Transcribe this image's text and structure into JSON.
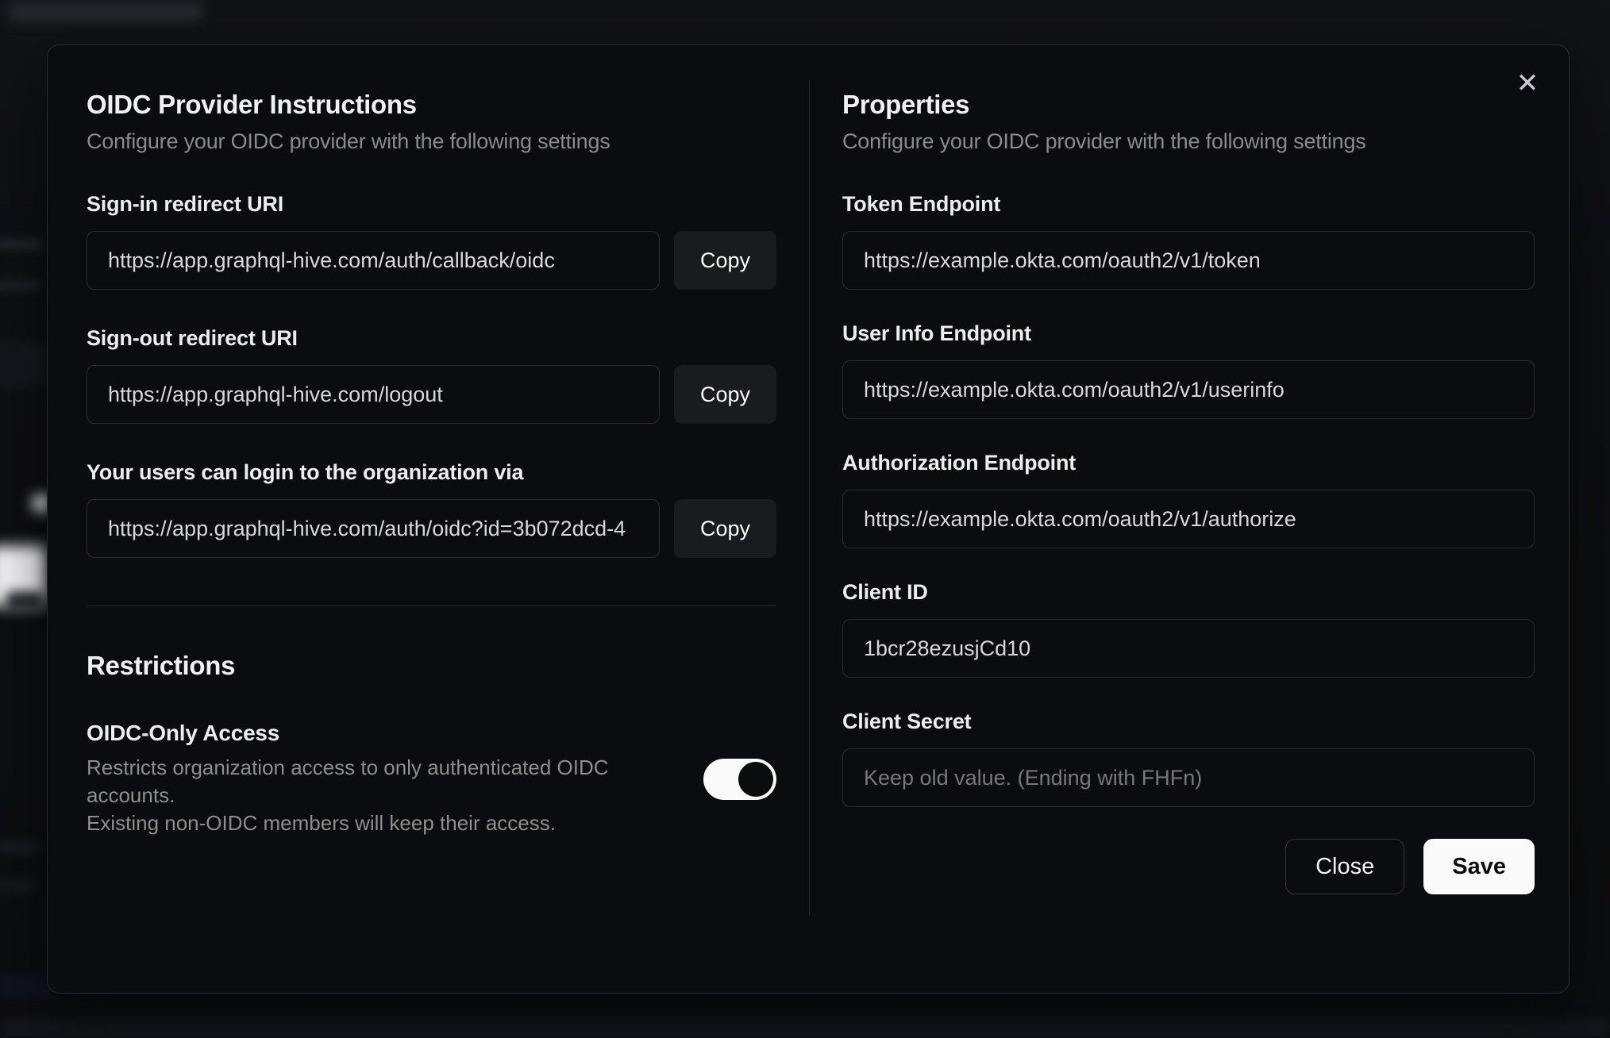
{
  "modal": {
    "close_icon": "✕",
    "left": {
      "title": "OIDC Provider Instructions",
      "subtitle": "Configure your OIDC provider with the following settings",
      "copy_label": "Copy",
      "fields": [
        {
          "label": "Sign-in redirect URI",
          "value": "https://app.graphql-hive.com/auth/callback/oidc"
        },
        {
          "label": "Sign-out redirect URI",
          "value": "https://app.graphql-hive.com/logout"
        },
        {
          "label": "Your users can login to the organization via",
          "value": "https://app.graphql-hive.com/auth/oidc?id=3b072dcd-4"
        }
      ],
      "restrictions": {
        "title": "Restrictions",
        "toggle_name": "OIDC-Only Access",
        "toggle_description_line1": "Restricts organization access to only authenticated OIDC accounts.",
        "toggle_description_line2": "Existing non-OIDC members will keep their access.",
        "toggle_state": "on"
      }
    },
    "right": {
      "title": "Properties",
      "subtitle": "Configure your OIDC provider with the following settings",
      "fields": [
        {
          "label": "Token Endpoint",
          "value": "https://example.okta.com/oauth2/v1/token"
        },
        {
          "label": "User Info Endpoint",
          "value": "https://example.okta.com/oauth2/v1/userinfo"
        },
        {
          "label": "Authorization Endpoint",
          "value": "https://example.okta.com/oauth2/v1/authorize"
        },
        {
          "label": "Client ID",
          "value": "1bcr28ezusjCd10"
        },
        {
          "label": "Client Secret",
          "value": "",
          "placeholder": "Keep old value. (Ending with FHFn)"
        }
      ],
      "buttons": {
        "close": "Close",
        "save": "Save"
      }
    },
    "colors": {
      "modal_background": "#0b0c0f",
      "modal_border": "#2a2b2f",
      "input_border": "#2b2c30",
      "copy_button_background": "#1a1b1e",
      "toggle_track": "#fafafa",
      "toggle_knob": "#0b0c0e",
      "save_button_background": "#fafafa",
      "muted_text": "#8b8b8f"
    }
  }
}
